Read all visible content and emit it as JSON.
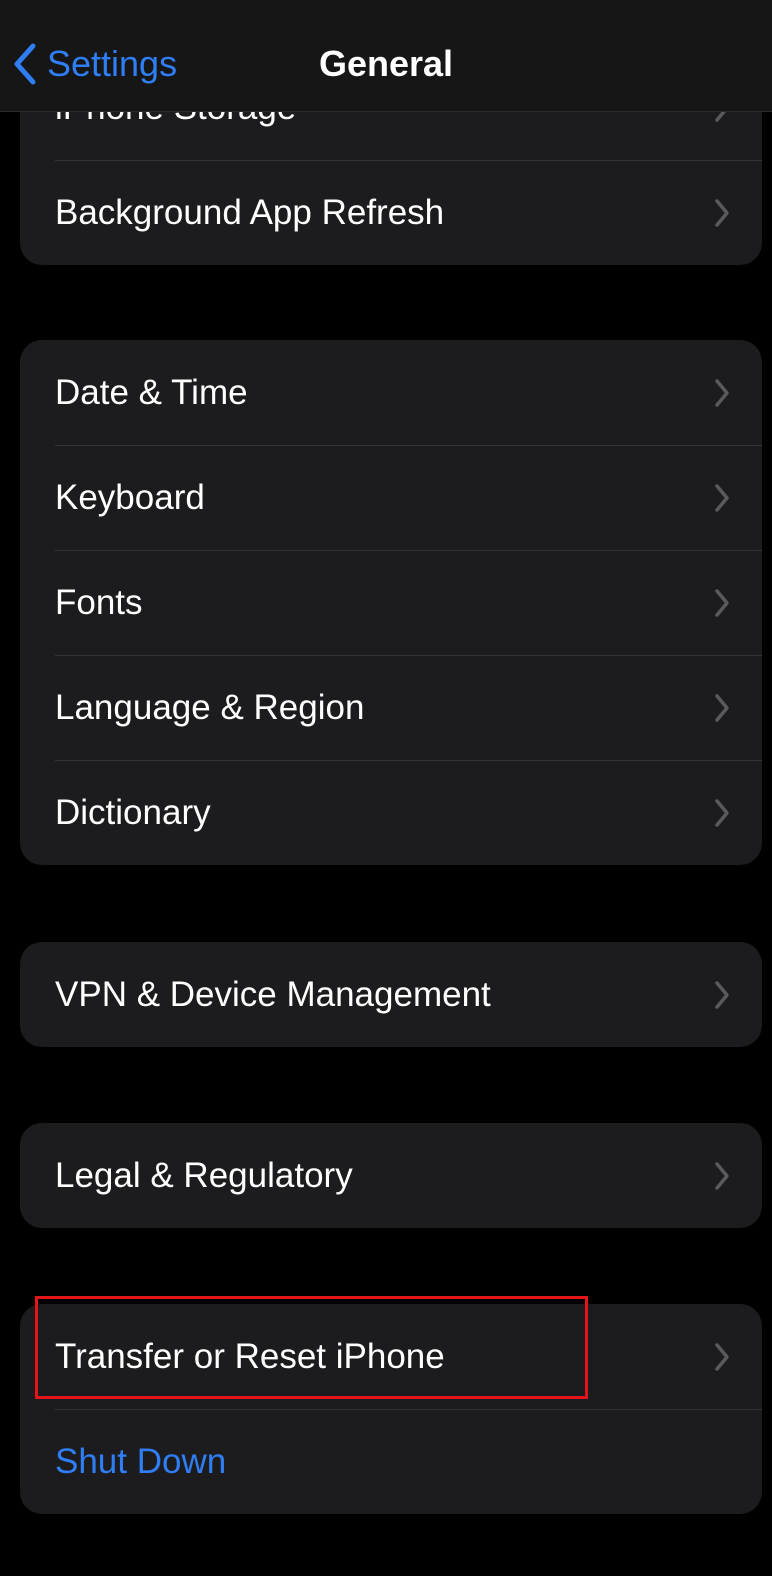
{
  "nav": {
    "back_label": "Settings",
    "title": "General"
  },
  "groups": {
    "storage": {
      "items": [
        "iPhone Storage",
        "Background App Refresh"
      ]
    },
    "locale": {
      "items": [
        "Date & Time",
        "Keyboard",
        "Fonts",
        "Language & Region",
        "Dictionary"
      ]
    },
    "vpn": {
      "items": [
        "VPN & Device Management"
      ]
    },
    "legal": {
      "items": [
        "Legal & Regulatory"
      ]
    },
    "reset": {
      "items": [
        "Transfer or Reset iPhone",
        "Shut Down"
      ]
    }
  },
  "colors": {
    "accent": "#2f7ef6",
    "background": "#000000",
    "group_background": "#1c1c1e",
    "highlight": "#e0161b"
  }
}
